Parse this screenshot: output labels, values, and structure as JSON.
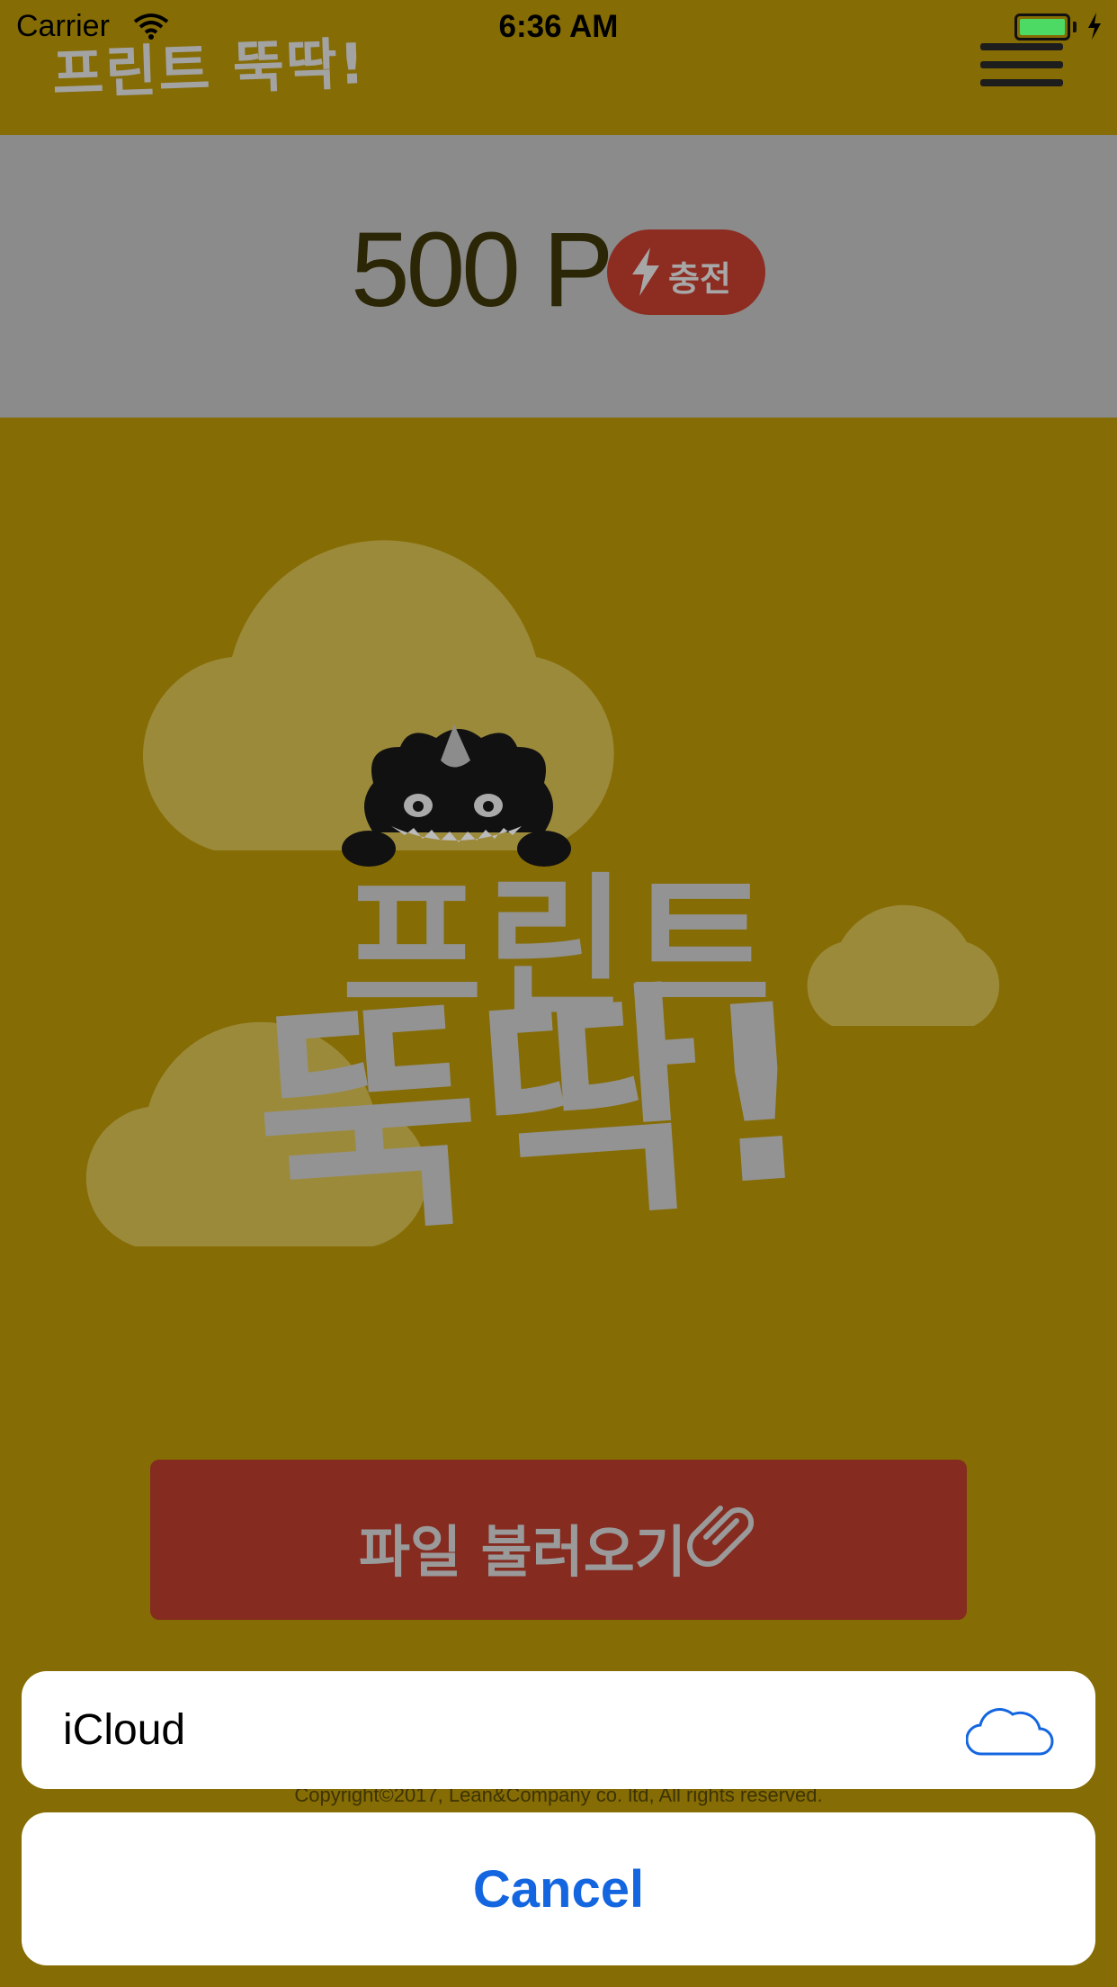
{
  "status_bar": {
    "carrier": "Carrier",
    "time": "6:36 AM",
    "battery_level": 1.0
  },
  "header": {
    "logo_text": "프린트 뚝딱!",
    "menu_icon": "hamburger-menu-icon"
  },
  "points": {
    "value": "500 P",
    "charge_label": "충전",
    "charge_icon": "lightning-icon"
  },
  "hero": {
    "title_top": "프린트",
    "title_bottom": "뚝딱!"
  },
  "load_file": {
    "label": "파일 불러오기",
    "icon": "paperclip-icon"
  },
  "footer": {
    "copyright": "Copyright©2017, Lean&Company co. ltd, All rights reserved."
  },
  "action_sheet": {
    "options": [
      {
        "label": "iCloud",
        "icon": "icloud-icon"
      }
    ],
    "cancel_label": "Cancel"
  },
  "colors": {
    "background": "#856c04",
    "points_bar": "#8b8b8b",
    "accent_red": "#852b20",
    "cancel_blue": "#1466e0"
  }
}
